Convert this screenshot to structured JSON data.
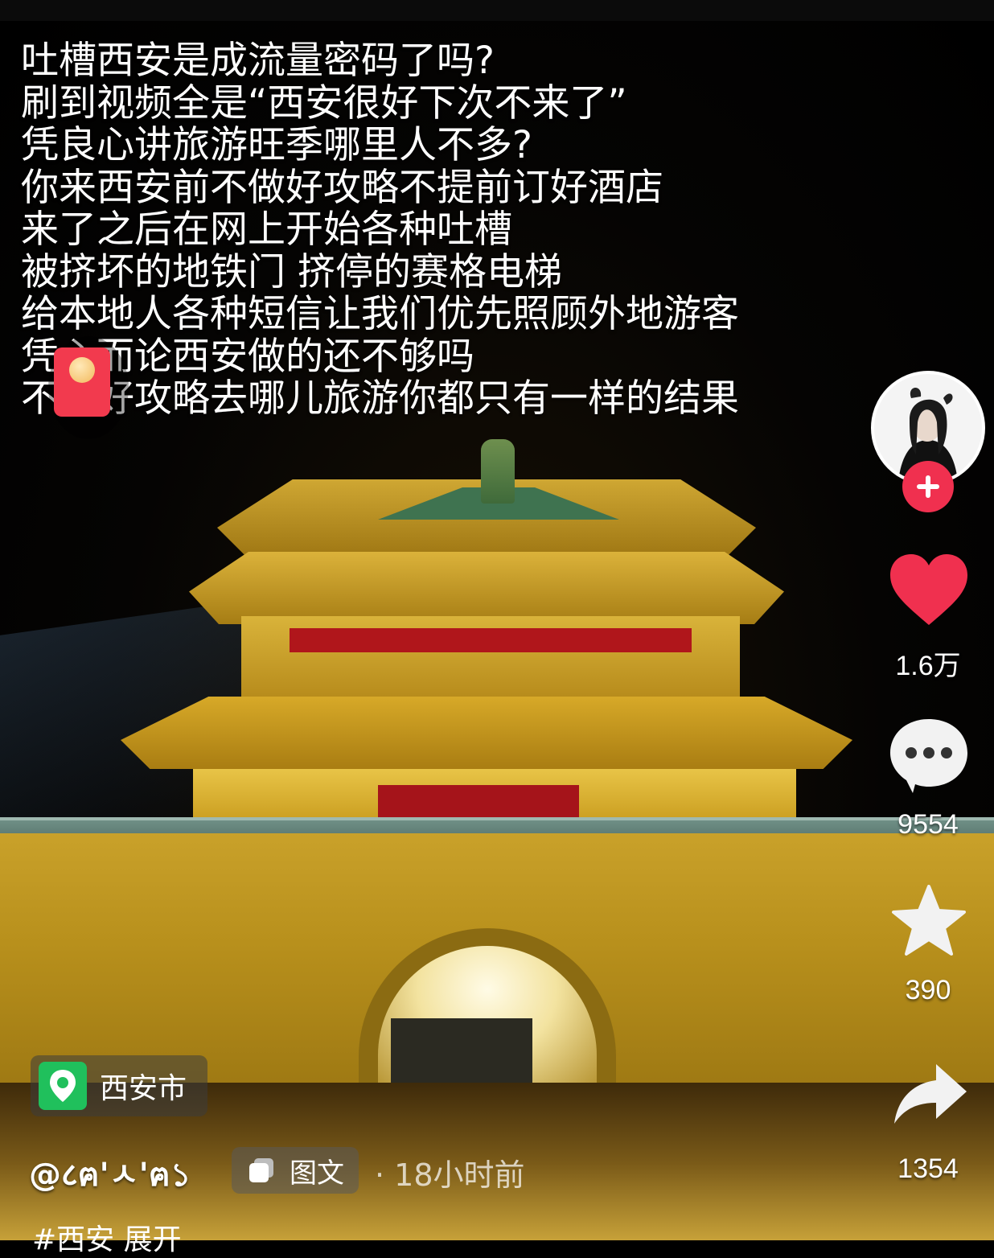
{
  "caption": {
    "lines": [
      "吐槽西安是成流量密码了吗?",
      "刷到视频全是“西安很好下次不来了”",
      "凭良心讲旅游旺季哪里人不多?",
      "你来西安前不做好攻略不提前订好酒店",
      "来了之后在网上开始各种吐槽",
      "被挤坏的地铁门 挤停的赛格电梯",
      "给本地人各种短信让我们优先照顾外地游客",
      "凭心而论西安做的还不够吗",
      "不做好攻略去哪儿旅游你都只有一样的结果"
    ]
  },
  "actions": {
    "like_count": "1.6万",
    "comment_count": "9554",
    "favorite_count": "390",
    "share_count": "1354"
  },
  "location": {
    "name": "西安市",
    "icon": "map-pin-icon"
  },
  "post": {
    "author": "@८ฅ'ㅅ'ฅ১",
    "type_label": "图文",
    "time": "· 18小时前",
    "tags_text": "#西安 展开"
  },
  "colors": {
    "accent": "#f0304f",
    "location_green": "#20c05c",
    "heart": "#f0304f"
  }
}
